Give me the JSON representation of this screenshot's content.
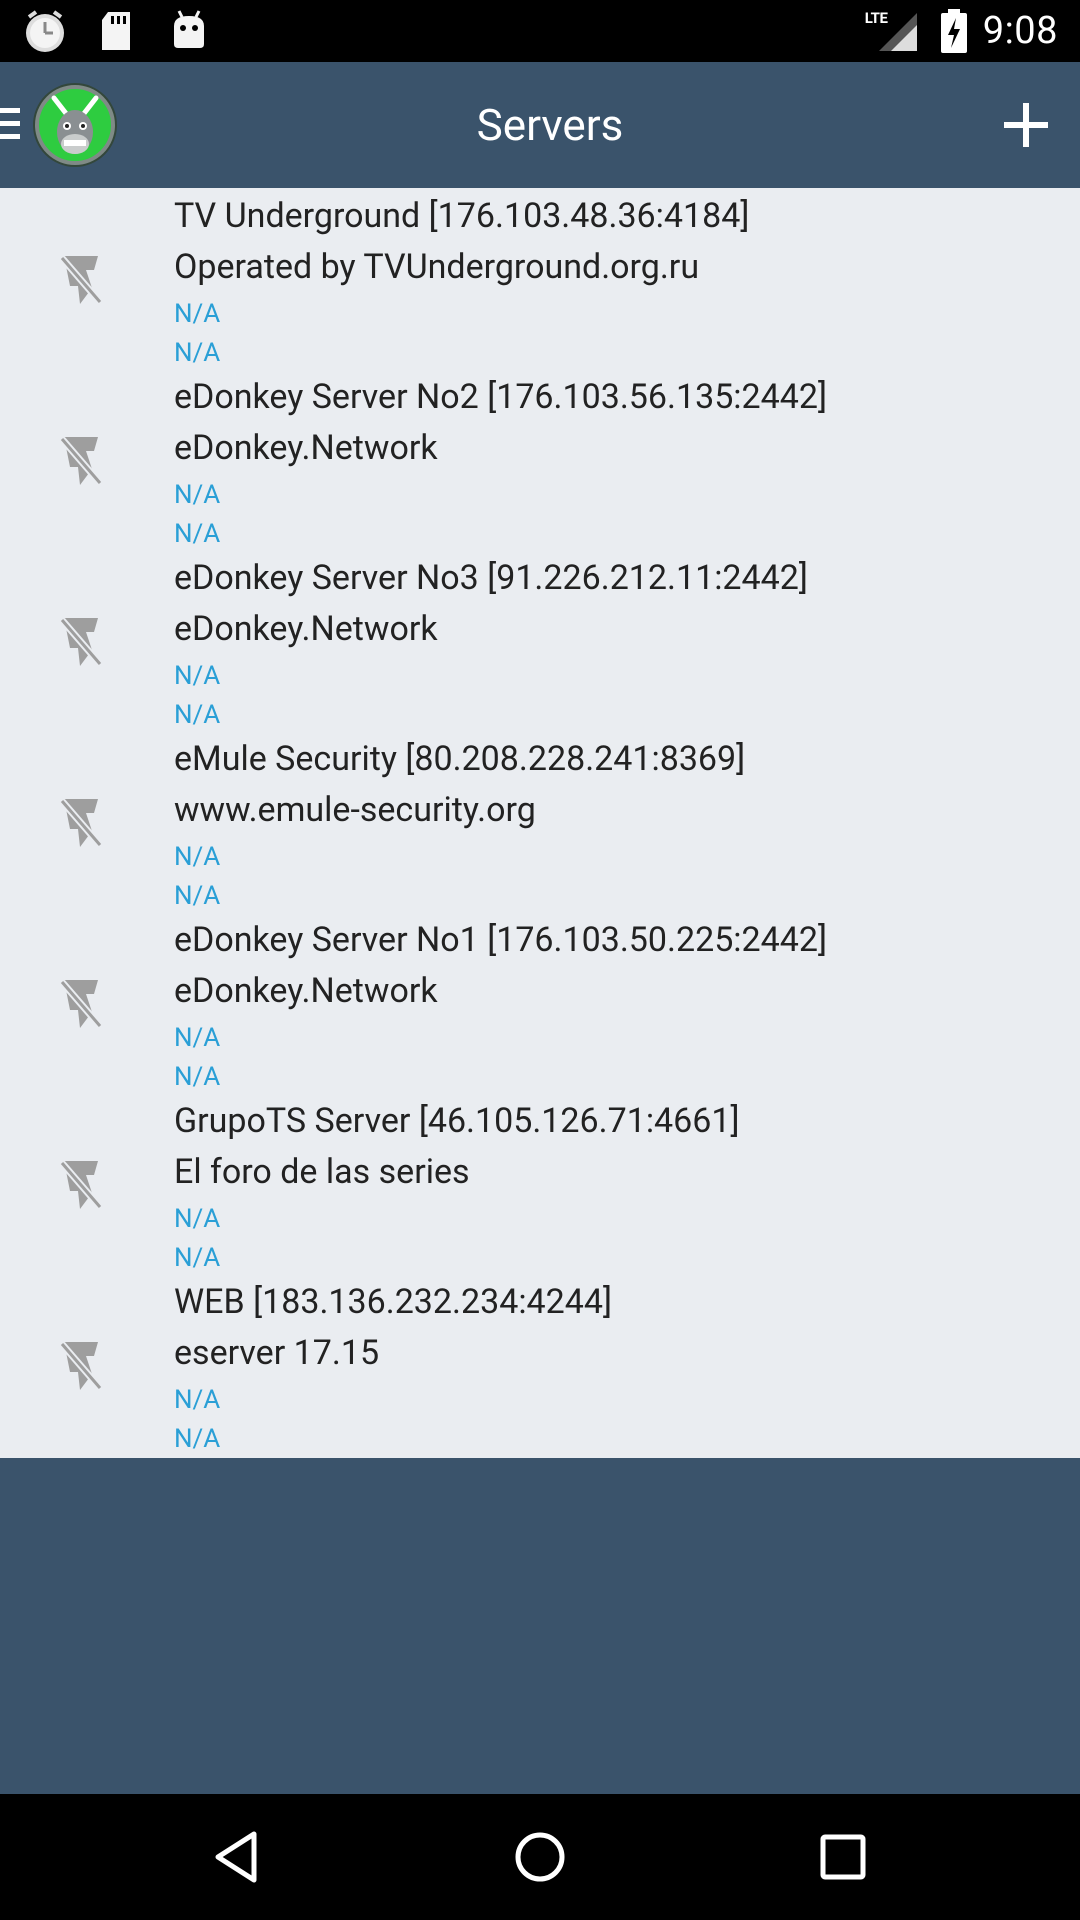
{
  "status_bar": {
    "network_type": "LTE",
    "time": "9:08",
    "icons": [
      "alarm-clock-icon",
      "sd-card-icon",
      "android-debug-icon",
      "signal-icon",
      "battery-charging-icon"
    ]
  },
  "app_bar": {
    "title": "Servers",
    "icons": [
      "menu-icon",
      "app-logo-icon",
      "add-icon"
    ]
  },
  "servers": [
    {
      "name": "TV Underground [176.103.48.36:4184]",
      "description": "Operated by TVUnderground.org.ru",
      "users": "N/A",
      "files": "N/A",
      "status_icon": "disconnected-icon"
    },
    {
      "name": "eDonkey Server No2 [176.103.56.135:2442]",
      "description": "eDonkey.Network",
      "users": "N/A",
      "files": "N/A",
      "status_icon": "disconnected-icon"
    },
    {
      "name": "eDonkey Server No3 [91.226.212.11:2442]",
      "description": "eDonkey.Network",
      "users": "N/A",
      "files": "N/A",
      "status_icon": "disconnected-icon"
    },
    {
      "name": "eMule Security [80.208.228.241:8369]",
      "description": "www.emule-security.org",
      "users": "N/A",
      "files": "N/A",
      "status_icon": "disconnected-icon"
    },
    {
      "name": "eDonkey Server No1 [176.103.50.225:2442]",
      "description": "eDonkey.Network",
      "users": "N/A",
      "files": "N/A",
      "status_icon": "disconnected-icon"
    },
    {
      "name": "GrupoTS Server [46.105.126.71:4661]",
      "description": "El foro de las series",
      "users": "N/A",
      "files": "N/A",
      "status_icon": "disconnected-icon"
    },
    {
      "name": "WEB [183.136.232.234:4244]",
      "description": "eserver 17.15",
      "users": "N/A",
      "files": "N/A",
      "status_icon": "disconnected-icon"
    }
  ],
  "nav_bar": {
    "icons": [
      "back-icon",
      "home-icon",
      "recents-icon"
    ]
  },
  "colors": {
    "app_bar": "#3a536b",
    "list_background": "#eaedf1",
    "accent_text": "#2a9fd6",
    "primary_text": "#222222"
  }
}
